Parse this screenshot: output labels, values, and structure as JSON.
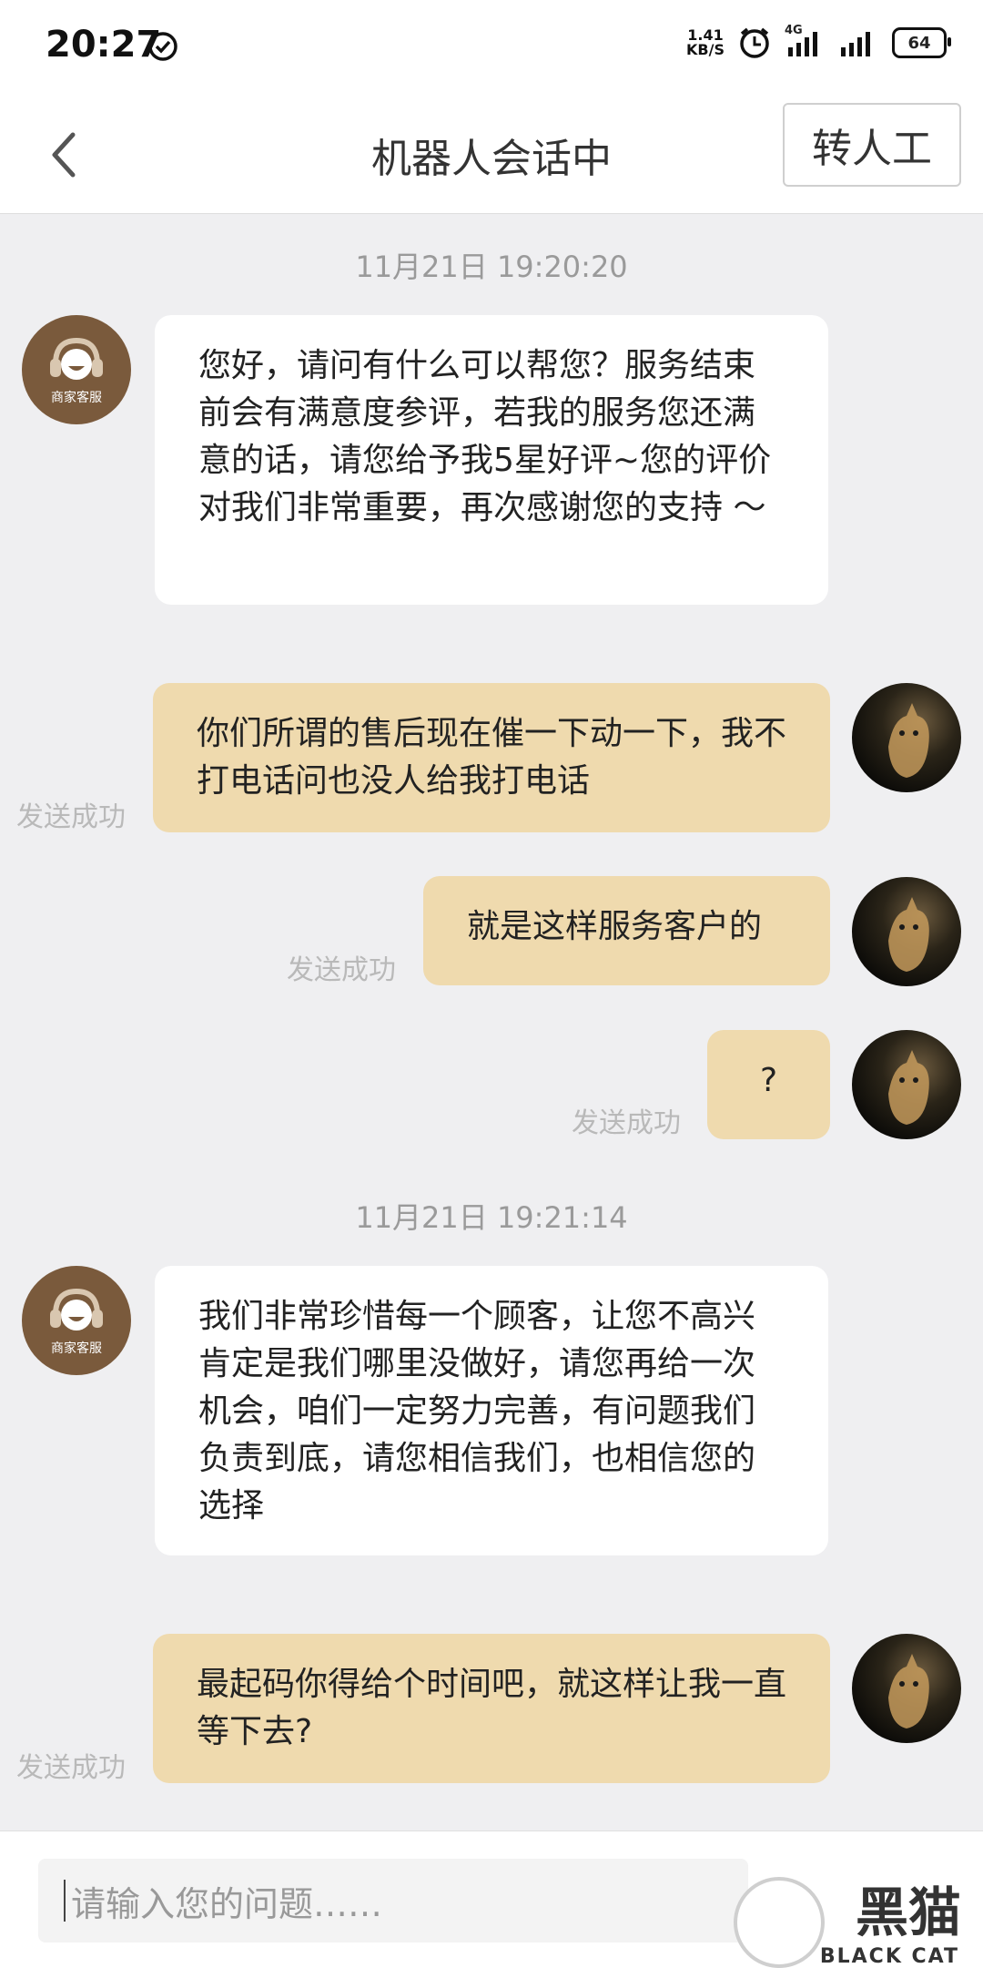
{
  "status_bar": {
    "time": "20:27",
    "speed_value": "1.41",
    "speed_unit": "KB/S",
    "network": "4G",
    "battery": "64"
  },
  "header": {
    "title": "机器人会话中",
    "transfer_label": "转人工"
  },
  "agent_avatar_label": "商家客服",
  "messages": [
    {
      "type": "timestamp",
      "text": "11月21日 19:20:20"
    },
    {
      "type": "incoming",
      "text": "您好，请问有什么可以帮您？服务结束前会有满意度参评，若我的服务您还满意的话，请您给予我5星好评~您的评价对我们非常重要，再次感谢您的支持 ～"
    },
    {
      "type": "outgoing",
      "text": "你们所谓的售后现在催一下动一下，我不打电话问也没人给我打电话",
      "status": "发送成功"
    },
    {
      "type": "outgoing",
      "text": "就是这样服务客户的",
      "status": "发送成功"
    },
    {
      "type": "outgoing",
      "text": "?",
      "status": "发送成功"
    },
    {
      "type": "timestamp",
      "text": "11月21日 19:21:14"
    },
    {
      "type": "incoming",
      "text": "我们非常珍惜每一个顾客，让您不高兴肯定是我们哪里没做好，请您再给一次机会，咱们一定努力完善，有问题我们负责到底，请您相信我们，也相信您的选择"
    },
    {
      "type": "outgoing",
      "text": "最起码你得给个时间吧，就这样让我一直等下去?",
      "status": "发送成功"
    }
  ],
  "input": {
    "placeholder": "请输入您的问题……"
  },
  "watermark": {
    "text": "黑猫",
    "sub": "BLACK CAT"
  }
}
